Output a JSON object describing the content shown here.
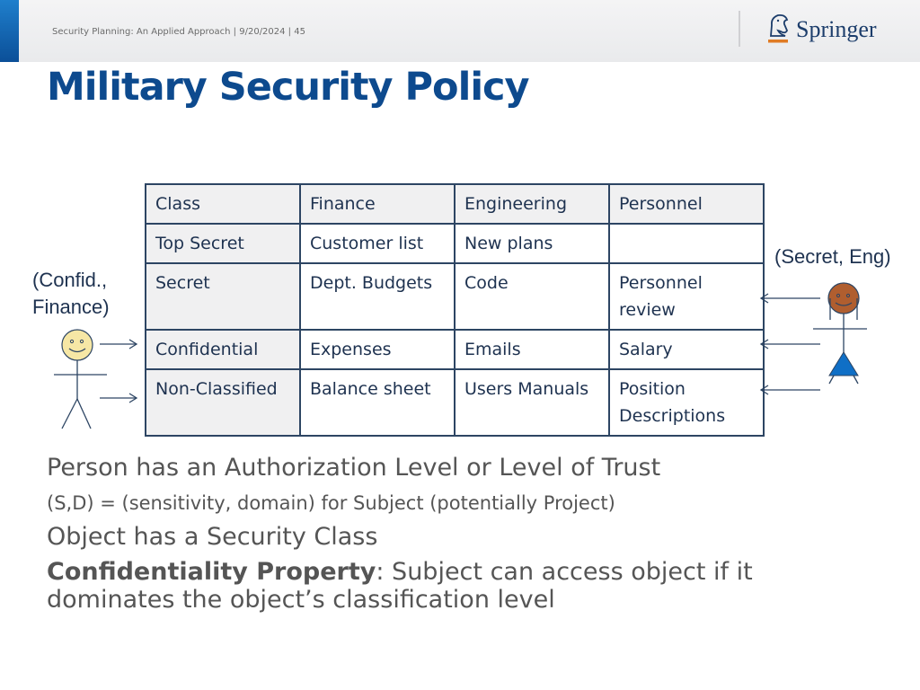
{
  "header": {
    "footer_text": "Security Planning: An Applied Approach | 9/20/2024 | 45",
    "logo_text": "Springer",
    "accent_color": "#0b4f98"
  },
  "slide": {
    "title": "Military Security Policy"
  },
  "table": {
    "header": [
      "Class",
      "Finance",
      "Engineering",
      "Personnel"
    ],
    "rows": [
      [
        "Top Secret",
        "Customer list",
        "New plans",
        ""
      ],
      [
        "Secret",
        "Dept. Budgets",
        "Code",
        "Personnel review"
      ],
      [
        "Confidential",
        "Expenses",
        "Emails",
        "Salary"
      ],
      [
        "Non-Classified",
        "Balance sheet",
        "Users Manuals",
        "Position Descriptions"
      ]
    ]
  },
  "subjects": {
    "left_label_line1": "(Confid.,",
    "left_label_line2": "Finance)",
    "right_label": "(Secret, Eng)"
  },
  "bullets": {
    "b1": "Person has an Authorization Level or Level of Trust",
    "b2": "(S,D) = (sensitivity, domain) for Subject (potentially Project)",
    "b3": "Object has a Security Class",
    "b4_bold": "Confidentiality Property",
    "b4_rest": ":  Subject can access object if it dominates the object’s classification level"
  }
}
